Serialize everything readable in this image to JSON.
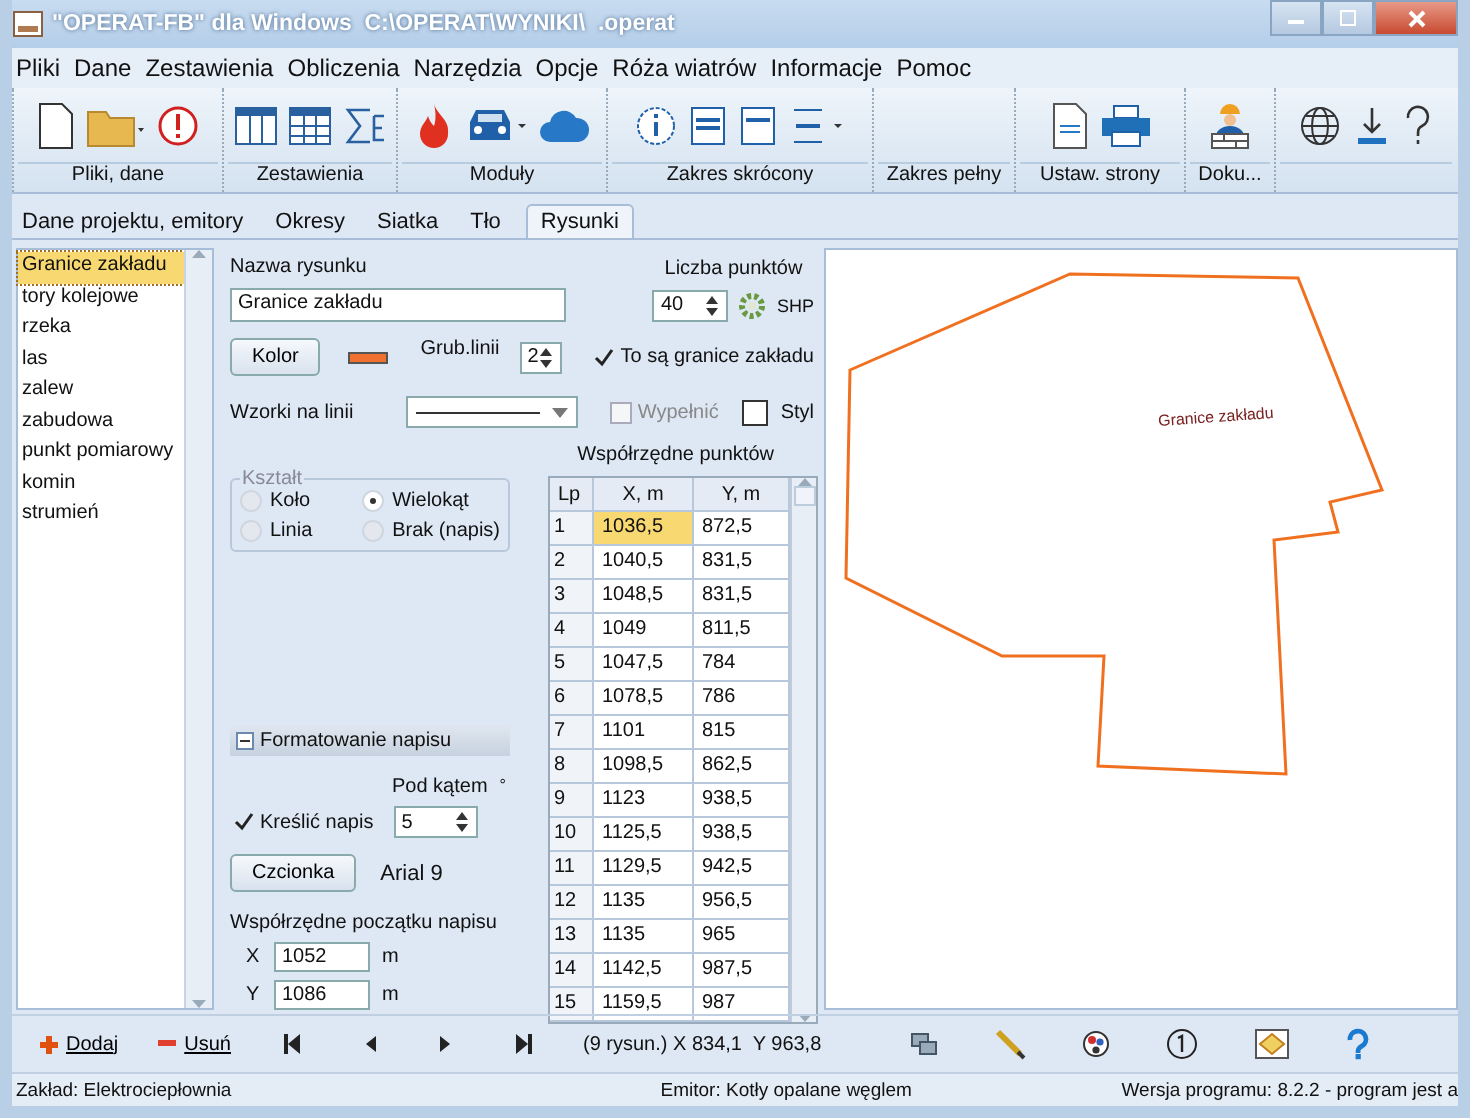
{
  "window": {
    "title": "\"OPERAT-FB\" dla Windows  C:\\OPERAT\\WYNIKI\\  .operat"
  },
  "menu": [
    "Pliki",
    "Dane",
    "Zestawienia",
    "Obliczenia",
    "Narzędzia",
    "Opcje",
    "Róża wiatrów",
    "Informacje",
    "Pomoc"
  ],
  "toolbar_groups": [
    {
      "label": "Pliki, dane"
    },
    {
      "label": "Zestawienia"
    },
    {
      "label": "Moduły"
    },
    {
      "label": "Zakres skrócony"
    },
    {
      "label": "Zakres pełny"
    },
    {
      "label": "Ustaw. strony"
    },
    {
      "label": "Doku..."
    }
  ],
  "tabs": [
    {
      "label": "Dane projektu, emitory",
      "selected": false
    },
    {
      "label": "Okresy",
      "selected": false
    },
    {
      "label": "Siatka",
      "selected": false
    },
    {
      "label": "Tło",
      "selected": false
    },
    {
      "label": "Rysunki",
      "selected": true
    }
  ],
  "drawings": [
    {
      "label": "Granice zakładu",
      "selected": true
    },
    {
      "label": "tory kolejowe",
      "selected": false
    },
    {
      "label": "rzeka",
      "selected": false
    },
    {
      "label": "las",
      "selected": false
    },
    {
      "label": "zalew",
      "selected": false
    },
    {
      "label": "zabudowa",
      "selected": false
    },
    {
      "label": "punkt pomiarowy",
      "selected": false
    },
    {
      "label": "komin",
      "selected": false
    },
    {
      "label": "strumień",
      "selected": false
    }
  ],
  "form": {
    "name_label": "Nazwa rysunku",
    "name_value": "Granice zakładu",
    "points_label": "Liczba punktów",
    "points_value": "40",
    "shp_label": "SHP",
    "color_button": "Kolor",
    "width_label": "Grub.linii",
    "width_value": "2",
    "boundary": {
      "label": "To są granice zakładu",
      "checked": true
    },
    "patterns_label": "Wzorki na linii",
    "fill": {
      "label": "Wypełnić",
      "checked": false,
      "disabled": true
    },
    "style_label": "Styl",
    "shape": {
      "title": "Kształt",
      "options": [
        {
          "label": "Koło",
          "selected": false
        },
        {
          "label": "Wielokąt",
          "selected": true
        },
        {
          "label": "Linia",
          "selected": false
        },
        {
          "label": "Brak (napis)",
          "selected": false
        }
      ]
    },
    "label_section": {
      "title": "Formatowanie napisu",
      "expanded": true,
      "angle_label": "Pod kątem",
      "angle_unit": "°",
      "draw": {
        "label": "Kreślić napis",
        "checked": true
      },
      "angle_value": "5",
      "font_button": "Czcionka",
      "font_value": "Arial 9",
      "origin_label": "Współrzędne początku napisu",
      "x_label": "X",
      "x_value": "1052",
      "x_unit": "m",
      "y_label": "Y",
      "y_value": "1086",
      "y_unit": "m"
    }
  },
  "points": {
    "title": "Współrzędne punktów",
    "columns": [
      "Lp",
      "X, m",
      "Y, m"
    ],
    "rows": [
      {
        "cells": [
          "1",
          "1036,5",
          "872,5"
        ],
        "selected": true
      },
      {
        "cells": [
          "2",
          "1040,5",
          "831,5"
        ],
        "selected": false
      },
      {
        "cells": [
          "3",
          "1048,5",
          "831,5"
        ],
        "selected": false
      },
      {
        "cells": [
          "4",
          "1049",
          "811,5"
        ],
        "selected": false
      },
      {
        "cells": [
          "5",
          "1047,5",
          "784"
        ],
        "selected": false
      },
      {
        "cells": [
          "6",
          "1078,5",
          "786"
        ],
        "selected": false
      },
      {
        "cells": [
          "7",
          "1101",
          "815"
        ],
        "selected": false
      },
      {
        "cells": [
          "8",
          "1098,5",
          "862,5"
        ],
        "selected": false
      },
      {
        "cells": [
          "9",
          "1123",
          "938,5"
        ],
        "selected": false
      },
      {
        "cells": [
          "10",
          "1125,5",
          "938,5"
        ],
        "selected": false
      },
      {
        "cells": [
          "11",
          "1129,5",
          "942,5"
        ],
        "selected": false
      },
      {
        "cells": [
          "12",
          "1135",
          "956,5"
        ],
        "selected": false
      },
      {
        "cells": [
          "13",
          "1135",
          "965"
        ],
        "selected": false
      },
      {
        "cells": [
          "14",
          "1142,5",
          "987,5"
        ],
        "selected": false
      },
      {
        "cells": [
          "15",
          "1159,5",
          "987"
        ],
        "selected": false
      }
    ]
  },
  "canvas": {
    "label": "Granice zakładu"
  },
  "bottom_toolbar": {
    "add": "Dodaj",
    "remove": "Usuń",
    "position": "(9 rysun.) X 834,1  Y 963,8"
  },
  "status_bar": [
    "Zakład: Elektrociepłownia",
    "Emitor: Kotły opalane węglem",
    "Wersja programu: 8.2.2 - program jest a"
  ]
}
